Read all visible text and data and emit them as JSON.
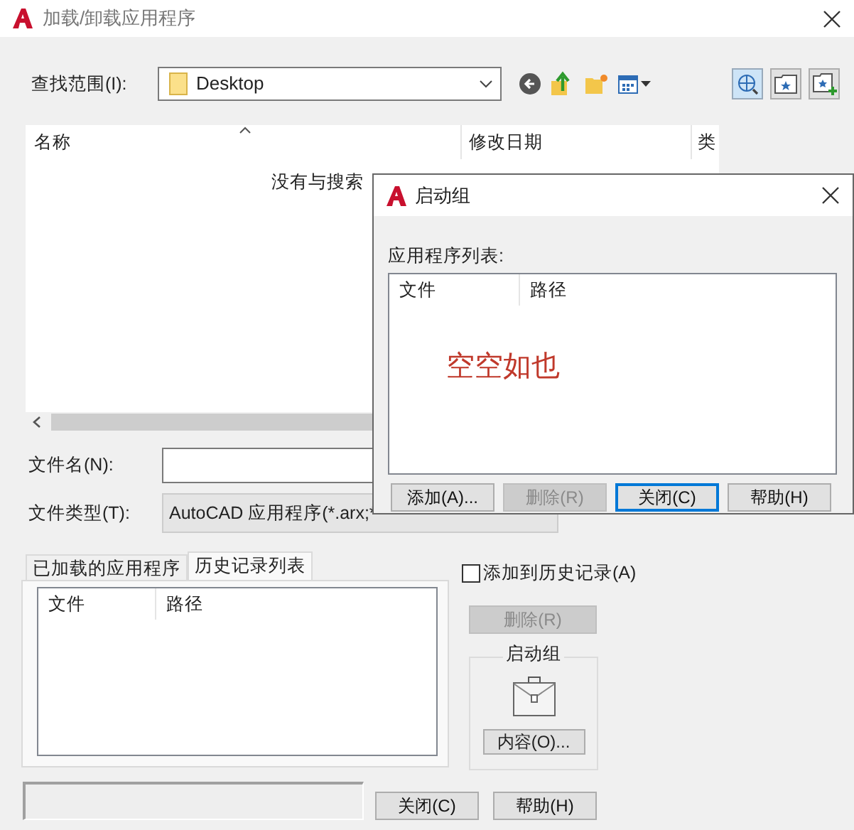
{
  "window": {
    "title": "加载/卸载应用程序"
  },
  "look_in": {
    "label": "查找范围(I):",
    "value": "Desktop"
  },
  "file_list": {
    "columns": [
      "名称",
      "修改日期",
      "类"
    ],
    "empty_message": "没有与搜索"
  },
  "file_name": {
    "label": "文件名(N):"
  },
  "file_type": {
    "label": "文件类型(T):",
    "value": "AutoCAD 应用程序(*.arx;*"
  },
  "tabs": [
    {
      "label": "已加载的应用程序",
      "selected": false
    },
    {
      "label": "历史记录列表",
      "selected": true
    }
  ],
  "history_list": {
    "columns": [
      "文件",
      "路径"
    ]
  },
  "add_to_history": {
    "label": "添加到历史记录(A)",
    "checked": false
  },
  "remove_button": {
    "label": "删除(R)",
    "disabled": true
  },
  "startup_group": {
    "title": "启动组",
    "button": "内容(O)..."
  },
  "buttons": [
    {
      "label": "关闭(C)"
    },
    {
      "label": "帮助(H)"
    }
  ],
  "startup_dialog": {
    "title": "启动组",
    "list_label": "应用程序列表:",
    "columns": [
      "文件",
      "路径"
    ],
    "note": "空空如也",
    "buttons": [
      {
        "label": "添加(A)...",
        "disabled": false,
        "focused": false
      },
      {
        "label": "删除(R)",
        "disabled": true,
        "focused": false
      },
      {
        "label": "关闭(C)",
        "disabled": false,
        "focused": true
      },
      {
        "label": "帮助(H)",
        "disabled": false,
        "focused": false
      }
    ]
  }
}
